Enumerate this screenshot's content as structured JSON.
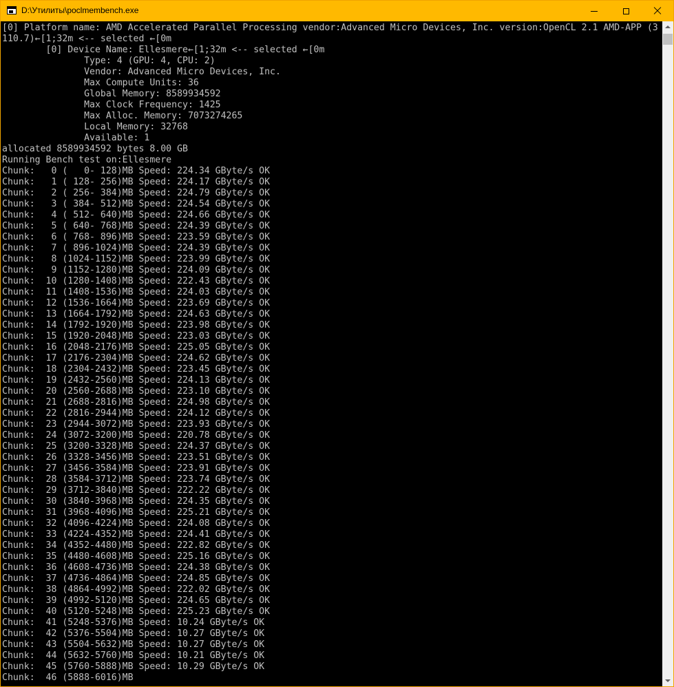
{
  "window": {
    "title": "D:\\Утилиты\\poclmembench.exe",
    "colors": {
      "titlebar": "#ffb900",
      "console_bg": "#000000",
      "console_fg": "#c0c0c0"
    },
    "controls": {
      "minimize": "minimize-icon",
      "maximize": "maximize-icon",
      "close": "close-icon"
    }
  },
  "console": {
    "lines": [
      "[0] Platform name: AMD Accelerated Parallel Processing vendor:Advanced Micro Devices, Inc. version:OpenCL 2.1 AMD-APP (3",
      "110.7)←[1;32m <-- selected ←[0m",
      "        [0] Device Name: Ellesmere←[1;32m <-- selected ←[0m",
      "               Type: 4 (GPU: 4, CPU: 2)",
      "               Vendor: Advanced Micro Devices, Inc.",
      "               Max Compute Units: 36",
      "               Global Memory: 8589934592",
      "               Max Clock Frequency: 1425",
      "               Max Alloc. Memory: 7073274265",
      "               Local Memory: 32768",
      "               Available: 1",
      "allocated 8589934592 bytes 8.00 GB",
      "Running Bench test on:Ellesmere",
      "Chunk:   0 (   0- 128)MB Speed: 224.34 GByte/s OK",
      "Chunk:   1 ( 128- 256)MB Speed: 224.17 GByte/s OK",
      "Chunk:   2 ( 256- 384)MB Speed: 224.79 GByte/s OK",
      "Chunk:   3 ( 384- 512)MB Speed: 224.54 GByte/s OK",
      "Chunk:   4 ( 512- 640)MB Speed: 224.66 GByte/s OK",
      "Chunk:   5 ( 640- 768)MB Speed: 224.39 GByte/s OK",
      "Chunk:   6 ( 768- 896)MB Speed: 223.59 GByte/s OK",
      "Chunk:   7 ( 896-1024)MB Speed: 224.39 GByte/s OK",
      "Chunk:   8 (1024-1152)MB Speed: 223.99 GByte/s OK",
      "Chunk:   9 (1152-1280)MB Speed: 224.09 GByte/s OK",
      "Chunk:  10 (1280-1408)MB Speed: 222.43 GByte/s OK",
      "Chunk:  11 (1408-1536)MB Speed: 224.03 GByte/s OK",
      "Chunk:  12 (1536-1664)MB Speed: 223.69 GByte/s OK",
      "Chunk:  13 (1664-1792)MB Speed: 224.63 GByte/s OK",
      "Chunk:  14 (1792-1920)MB Speed: 223.98 GByte/s OK",
      "Chunk:  15 (1920-2048)MB Speed: 223.03 GByte/s OK",
      "Chunk:  16 (2048-2176)MB Speed: 225.05 GByte/s OK",
      "Chunk:  17 (2176-2304)MB Speed: 224.62 GByte/s OK",
      "Chunk:  18 (2304-2432)MB Speed: 223.45 GByte/s OK",
      "Chunk:  19 (2432-2560)MB Speed: 224.13 GByte/s OK",
      "Chunk:  20 (2560-2688)MB Speed: 223.10 GByte/s OK",
      "Chunk:  21 (2688-2816)MB Speed: 224.98 GByte/s OK",
      "Chunk:  22 (2816-2944)MB Speed: 224.12 GByte/s OK",
      "Chunk:  23 (2944-3072)MB Speed: 223.93 GByte/s OK",
      "Chunk:  24 (3072-3200)MB Speed: 220.78 GByte/s OK",
      "Chunk:  25 (3200-3328)MB Speed: 224.37 GByte/s OK",
      "Chunk:  26 (3328-3456)MB Speed: 223.51 GByte/s OK",
      "Chunk:  27 (3456-3584)MB Speed: 223.91 GByte/s OK",
      "Chunk:  28 (3584-3712)MB Speed: 223.74 GByte/s OK",
      "Chunk:  29 (3712-3840)MB Speed: 222.22 GByte/s OK",
      "Chunk:  30 (3840-3968)MB Speed: 224.35 GByte/s OK",
      "Chunk:  31 (3968-4096)MB Speed: 225.21 GByte/s OK",
      "Chunk:  32 (4096-4224)MB Speed: 224.08 GByte/s OK",
      "Chunk:  33 (4224-4352)MB Speed: 224.41 GByte/s OK",
      "Chunk:  34 (4352-4480)MB Speed: 222.82 GByte/s OK",
      "Chunk:  35 (4480-4608)MB Speed: 225.16 GByte/s OK",
      "Chunk:  36 (4608-4736)MB Speed: 224.38 GByte/s OK",
      "Chunk:  37 (4736-4864)MB Speed: 224.85 GByte/s OK",
      "Chunk:  38 (4864-4992)MB Speed: 222.02 GByte/s OK",
      "Chunk:  39 (4992-5120)MB Speed: 224.65 GByte/s OK",
      "Chunk:  40 (5120-5248)MB Speed: 225.23 GByte/s OK",
      "Chunk:  41 (5248-5376)MB Speed: 10.24 GByte/s OK",
      "Chunk:  42 (5376-5504)MB Speed: 10.27 GByte/s OK",
      "Chunk:  43 (5504-5632)MB Speed: 10.27 GByte/s OK",
      "Chunk:  44 (5632-5760)MB Speed: 10.21 GByte/s OK",
      "Chunk:  45 (5760-5888)MB Speed: 10.29 GByte/s OK",
      "Chunk:  46 (5888-6016)MB"
    ]
  },
  "scrollbar": {
    "up_icon": "scroll-up-arrow-icon",
    "down_icon": "scroll-down-arrow-icon"
  }
}
